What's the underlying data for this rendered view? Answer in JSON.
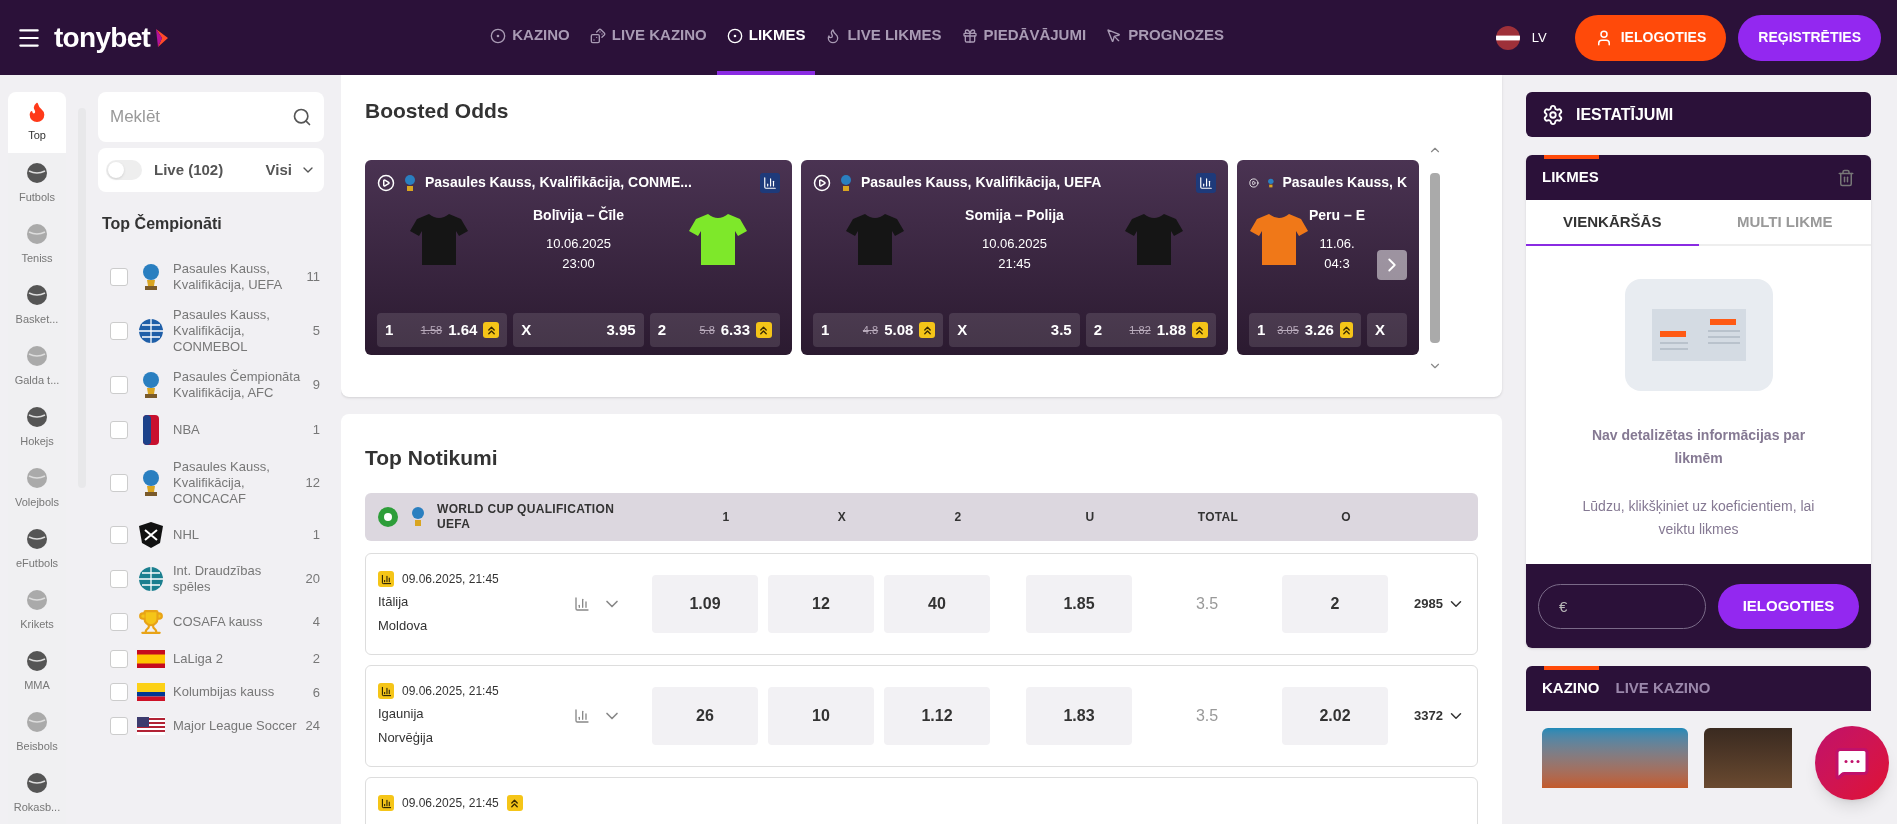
{
  "header": {
    "logo": "tonybet",
    "nav": [
      {
        "label": "KAZINO",
        "selected": false
      },
      {
        "label": "LIVE KAZINO",
        "selected": false
      },
      {
        "label": "LIKMES",
        "selected": true
      },
      {
        "label": "LIVE LIKMES",
        "selected": false
      },
      {
        "label": "PIEDĀVĀJUMI",
        "selected": false
      },
      {
        "label": "PROGNOZES",
        "selected": false
      }
    ],
    "language": "LV",
    "login": "IELOGOTIES",
    "register": "REĢISTRĒTIES"
  },
  "sports": [
    {
      "label": "Top",
      "selected": true
    },
    {
      "label": "Futbols",
      "selected": false
    },
    {
      "label": "Teniss",
      "selected": false
    },
    {
      "label": "Basket...",
      "selected": false
    },
    {
      "label": "Galda t...",
      "selected": false
    },
    {
      "label": "Hokejs",
      "selected": false
    },
    {
      "label": "Volejbols",
      "selected": false
    },
    {
      "label": "eFutbols",
      "selected": false
    },
    {
      "label": "Krikets",
      "selected": false
    },
    {
      "label": "MMA",
      "selected": false
    },
    {
      "label": "Beisbols",
      "selected": false
    },
    {
      "label": "Rokasb...",
      "selected": false
    }
  ],
  "filters": {
    "search": {
      "placeholder": "Meklēt"
    },
    "live": {
      "label": "Live (102)",
      "on": false
    },
    "scope": "Visi"
  },
  "championships": {
    "title": "Top Čempionāti",
    "items": [
      {
        "name": "Pasaules Kauss, Kvalifikācija, UEFA",
        "count": "11",
        "checked": false
      },
      {
        "name": "Pasaules Kauss, Kvalifikācija, CONMEBOL",
        "count": "5",
        "checked": false
      },
      {
        "name": "Pasaules Čempionāta Kvalifikācija, AFC",
        "count": "9",
        "checked": false
      },
      {
        "name": "NBA",
        "count": "1",
        "checked": false
      },
      {
        "name": "Pasaules Kauss, Kvalifikācija, CONCACAF",
        "count": "12",
        "checked": false
      },
      {
        "name": "NHL",
        "count": "1",
        "checked": false
      },
      {
        "name": "Int. Draudzības spēles",
        "count": "20",
        "checked": false
      },
      {
        "name": "COSAFA kauss",
        "count": "4",
        "checked": false
      },
      {
        "name": "LaLiga 2",
        "count": "2",
        "checked": false
      },
      {
        "name": "Kolumbijas kauss",
        "count": "6",
        "checked": false
      },
      {
        "name": "Major League Soccer",
        "count": "24",
        "checked": false
      }
    ]
  },
  "boosted": {
    "title": "Boosted Odds",
    "cards": [
      {
        "league": "Pasaules Kauss, Kvalifikācija, CONME...",
        "match": "Bolīvija – Čīle",
        "date": "10.06.2025",
        "time": "23:00",
        "shirts": [
          {
            "color": "#151515"
          },
          {
            "color": "#7ee82a"
          }
        ],
        "odds": [
          {
            "label": "1",
            "old": "1.58",
            "value": "1.64",
            "boosted": true
          },
          {
            "label": "X",
            "value": "3.95",
            "boosted": false
          },
          {
            "label": "2",
            "old": "5.8",
            "value": "6.33",
            "boosted": true
          }
        ]
      },
      {
        "league": "Pasaules Kauss, Kvalifikācija, UEFA",
        "match": "Somija – Polija",
        "date": "10.06.2025",
        "time": "21:45",
        "shirts": [
          {
            "color": "#151515"
          },
          {
            "color": "#151515"
          }
        ],
        "odds": [
          {
            "label": "1",
            "old": "4.8",
            "value": "5.08",
            "boosted": true
          },
          {
            "label": "X",
            "value": "3.5",
            "boosted": false
          },
          {
            "label": "2",
            "old": "1.82",
            "value": "1.88",
            "boosted": true
          }
        ]
      },
      {
        "league": "Pasaules Kauss, K",
        "match": "Peru – E",
        "date": "11.06.",
        "time": "04:3",
        "shirts": [
          {
            "color": "#f07818"
          }
        ],
        "odds": [
          {
            "label": "1",
            "old": "3.05",
            "value": "3.26",
            "boosted": true
          },
          {
            "label": "X",
            "boosted": false
          }
        ]
      }
    ]
  },
  "top_events": {
    "title": "Top Notikumi",
    "league": "WORLD CUP QUALIFICATION UEFA",
    "columns": [
      "1",
      "X",
      "2",
      "U",
      "TOTAL",
      "O"
    ],
    "rows": [
      {
        "date": "09.06.2025, 21:45",
        "boosted": false,
        "home": "Itālija",
        "away": "Moldova",
        "odds": [
          "1.09",
          "12",
          "40"
        ],
        "under": "1.85",
        "total": "3.5",
        "over": "2",
        "markets": "2985"
      },
      {
        "date": "09.06.2025, 21:45",
        "boosted": false,
        "home": "Igaunija",
        "away": "Norvēģija",
        "odds": [
          "26",
          "10",
          "1.12"
        ],
        "under": "1.83",
        "total": "3.5",
        "over": "2.02",
        "markets": "3372"
      },
      {
        "date": "09.06.2025, 21:45",
        "boosted": true
      }
    ]
  },
  "betslip": {
    "settings": "IESTATĪJUMI",
    "title": "LIKMES",
    "tabs": [
      {
        "label": "VIENKĀRŠĀS",
        "selected": true
      },
      {
        "label": "MULTI LIKME",
        "selected": false
      }
    ],
    "empty_title": "Nav detalizētas informācijas par likmēm",
    "empty_text": "Lūdzu, klikšķiniet uz koeficientiem, lai veiktu likmes",
    "stake": {
      "placeholder": "€"
    },
    "login": "IELOGOTIES"
  },
  "casino": {
    "tabs": [
      {
        "label": "KAZINO",
        "selected": true
      },
      {
        "label": "LIVE KAZINO",
        "selected": false
      }
    ]
  }
}
